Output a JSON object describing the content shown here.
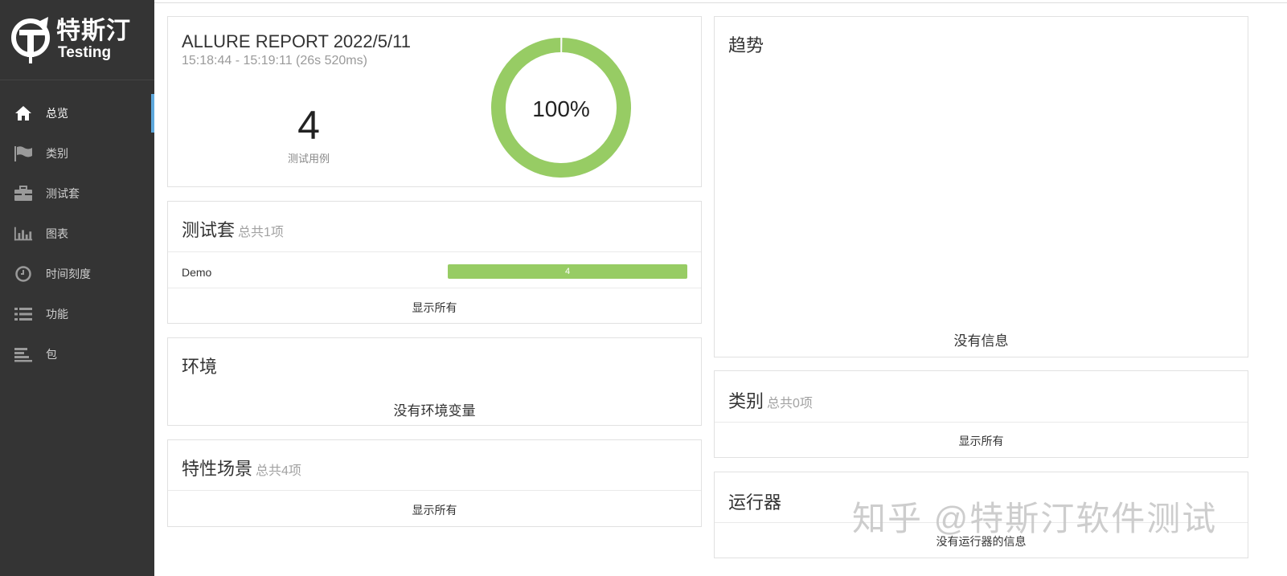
{
  "brand": {
    "name_cn": "特斯汀",
    "name_en": "Testing"
  },
  "sidebar": {
    "items": [
      {
        "label": "总览",
        "icon": "home-icon",
        "active": true
      },
      {
        "label": "类别",
        "icon": "flag-icon"
      },
      {
        "label": "测试套",
        "icon": "briefcase-icon"
      },
      {
        "label": "图表",
        "icon": "bar-chart-icon"
      },
      {
        "label": "时间刻度",
        "icon": "clock-icon"
      },
      {
        "label": "功能",
        "icon": "list-icon"
      },
      {
        "label": "包",
        "icon": "align-left-icon"
      }
    ]
  },
  "summary": {
    "title": "ALLURE REPORT 2022/5/11",
    "time": "15:18:44 - 15:19:11 (26s 520ms)",
    "cases_count": "4",
    "cases_label": "测试用例",
    "percent": "100%",
    "pass_fraction": 1.0,
    "pass_color": "#97cc64"
  },
  "suites": {
    "title": "测试套",
    "total": "总共1项",
    "rows": [
      {
        "name": "Demo",
        "count": "4"
      }
    ],
    "show_all": "显示所有"
  },
  "environment": {
    "title": "环境",
    "empty": "没有环境变量"
  },
  "features": {
    "title": "特性场景",
    "total": "总共4项",
    "show_all": "显示所有"
  },
  "trend": {
    "title": "趋势",
    "empty": "没有信息"
  },
  "categories": {
    "title": "类别",
    "total": "总共0项",
    "show_all": "显示所有"
  },
  "executors": {
    "title": "运行器",
    "empty": "没有运行器的信息"
  },
  "watermark": "知乎 @特斯汀软件测试"
}
